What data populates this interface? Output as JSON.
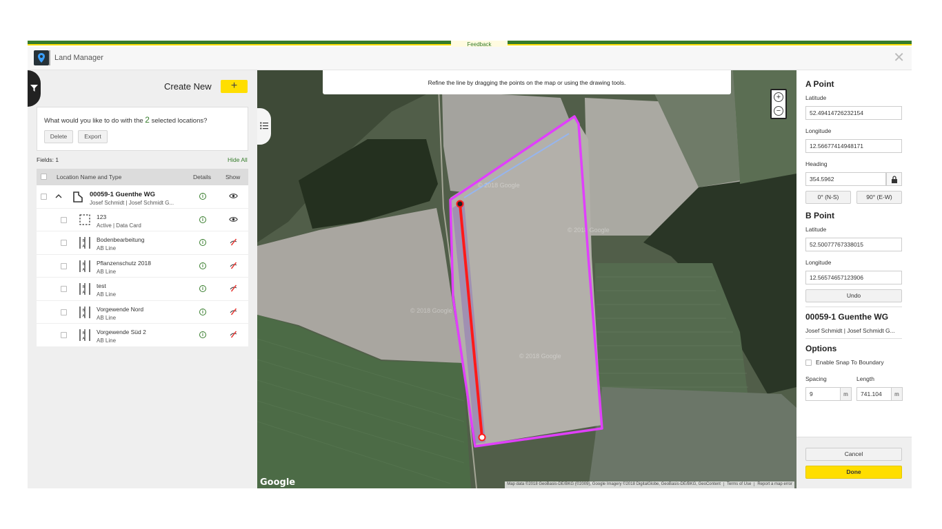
{
  "app": {
    "feedback_label": "Feedback",
    "title": "Land Manager",
    "brand_colors": {
      "green": "#367c2b",
      "yellow": "#ffde00"
    }
  },
  "left_panel": {
    "create_new_label": "Create New",
    "add_button_label": "+",
    "selection": {
      "prompt_before": "What would you like to do with the",
      "count": "2",
      "prompt_after": "selected locations?",
      "delete_label": "Delete",
      "export_label": "Export"
    },
    "fields_count": "Fields: 1",
    "hide_all_label": "Hide All",
    "table": {
      "headers": {
        "name": "Location Name and Type",
        "details": "Details",
        "show": "Show"
      },
      "rows": [
        {
          "name": "00059-1 Guenthe WG",
          "sub": "Josef Schmidt | Josef Schmidt G...",
          "icon": "field-boundary-icon",
          "visibility": "eye-icon",
          "indent": 0
        },
        {
          "name": "123",
          "sub": "Active | Data Card",
          "icon": "boundary-dashed-icon",
          "visibility": "eye-icon",
          "indent": 1
        },
        {
          "name": "Bodenbearbeitung",
          "sub": "AB Line",
          "icon": "ab-line-icon",
          "visibility": "hidden-icon",
          "indent": 1
        },
        {
          "name": "Pflanzenschutz 2018",
          "sub": "AB Line",
          "icon": "ab-line-icon",
          "visibility": "hidden-icon",
          "indent": 1
        },
        {
          "name": "test",
          "sub": "AB Line",
          "icon": "ab-line-icon",
          "visibility": "hidden-icon",
          "indent": 1
        },
        {
          "name": "Vorgewende Nord",
          "sub": "AB Line",
          "icon": "ab-line-icon",
          "visibility": "hidden-icon",
          "indent": 1
        },
        {
          "name": "Vorgewende Süd 2",
          "sub": "AB Line",
          "icon": "ab-line-icon",
          "visibility": "hidden-icon",
          "indent": 1
        }
      ]
    }
  },
  "map": {
    "instruction": "Refine the line by dragging the points on the map or using the drawing tools.",
    "zoom_in": "+",
    "zoom_out": "−",
    "provider_logo": "Google",
    "attribution": [
      "Map data ©2018 GeoBasis-DE/BKG (©2009), Google Imagery ©2018 DigitalGlobe, GeoBasis-DE/BKG, GeoContent",
      "Terms of Use",
      "Report a map error"
    ],
    "watermarks": [
      "© 2018 Google",
      "© 2018 Google",
      "© 2018 Google",
      "© 2018 Google"
    ],
    "colors": {
      "boundary": "#e040fb",
      "line": "#ff1a1a"
    }
  },
  "right_panel": {
    "a_point": {
      "title": "A Point",
      "lat_label": "Latitude",
      "lat": "52.49414726232154",
      "lon_label": "Longitude",
      "lon": "12.56677414948171"
    },
    "heading": {
      "label": "Heading",
      "value": "354.5962",
      "ns_label": "0° (N-S)",
      "ew_label": "90° (E-W)"
    },
    "b_point": {
      "title": "B Point",
      "lat_label": "Latitude",
      "lat": "52.50077767338015",
      "lon_label": "Longitude",
      "lon": "12.56574657123906"
    },
    "undo_label": "Undo",
    "field": {
      "name": "00059-1 Guenthe WG",
      "owner": "Josef Schmidt | Josef Schmidt G..."
    },
    "options": {
      "title": "Options",
      "snap_label": "Enable Snap To Boundary",
      "spacing_label": "Spacing",
      "spacing": "9",
      "length_label": "Length",
      "length": "741.104",
      "unit": "m"
    },
    "cancel_label": "Cancel",
    "done_label": "Done"
  }
}
